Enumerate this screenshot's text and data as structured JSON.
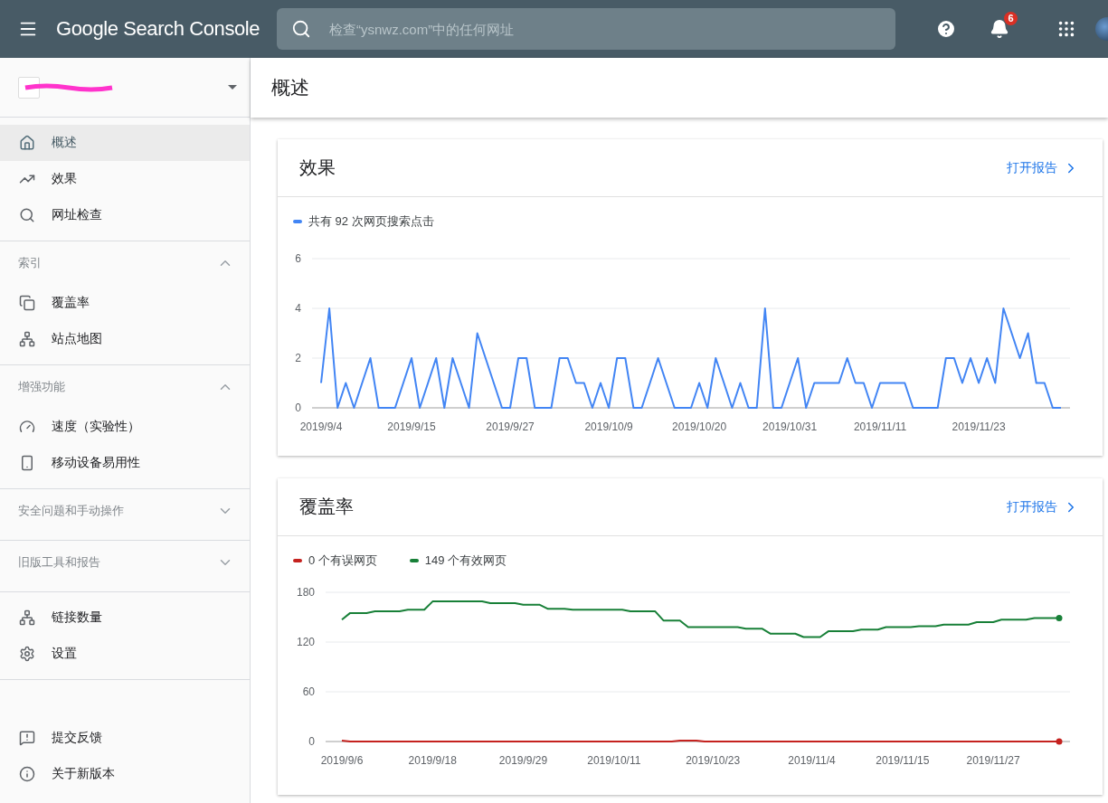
{
  "topbar": {
    "product": "Google Search Console",
    "search": {
      "placeholder": "检查“ysnwz.com”中的任何网址"
    },
    "notification_count": "6"
  },
  "nav": [
    {
      "items": [
        {
          "label": "概述",
          "selected": true
        },
        {
          "label": "效果",
          "selected": false
        },
        {
          "label": "网址检查",
          "selected": false
        }
      ]
    },
    {
      "title": "索引",
      "expanded": true,
      "items": [
        {
          "label": "覆盖率",
          "selected": false
        },
        {
          "label": "站点地图",
          "selected": false
        }
      ]
    },
    {
      "title": "增强功能",
      "expanded": true,
      "items": [
        {
          "label": "速度（实验性）",
          "selected": false
        },
        {
          "label": "移动设备易用性",
          "selected": false
        }
      ]
    },
    {
      "title": "安全问题和手动操作",
      "expanded": false
    },
    {
      "title": "旧版工具和报告",
      "expanded": false
    },
    {
      "items": [
        {
          "label": "链接数量",
          "selected": false
        },
        {
          "label": "设置",
          "selected": false
        }
      ]
    },
    {
      "items": [
        {
          "label": "提交反馈",
          "selected": false
        },
        {
          "label": "关于新版本",
          "selected": false
        }
      ]
    }
  ],
  "page_title": "概述",
  "cards": [
    {
      "title": "效果",
      "link": "打开报告",
      "x_axis_labels": [
        "2019/9/4",
        "2019/9/15",
        "2019/9/27",
        "2019/10/9",
        "2019/10/20",
        "2019/10/31",
        "2019/11/11",
        "2019/11/23"
      ],
      "chart_data": {
        "type": "line",
        "ylim": [
          0,
          6
        ],
        "yticks": [
          0,
          2,
          4,
          6
        ],
        "series": [
          {
            "name": "共有 92 次网页搜索点击",
            "color": "#4285f4",
            "values": [
              1,
              4,
              0,
              1,
              0,
              1,
              2,
              0,
              0,
              0,
              1,
              2,
              0,
              1,
              2,
              0,
              2,
              1,
              0,
              3,
              2,
              1,
              0,
              0,
              2,
              2,
              0,
              0,
              0,
              2,
              2,
              1,
              1,
              0,
              1,
              0,
              2,
              2,
              0,
              0,
              1,
              2,
              1,
              0,
              0,
              0,
              1,
              0,
              2,
              1,
              0,
              1,
              0,
              0,
              4,
              0,
              0,
              1,
              2,
              0,
              1,
              1,
              1,
              1,
              2,
              1,
              1,
              0,
              1,
              1,
              1,
              1,
              0,
              0,
              0,
              0,
              2,
              2,
              1,
              2,
              1,
              2,
              1,
              4,
              3,
              2,
              3,
              1,
              1,
              0,
              0
            ]
          }
        ]
      }
    },
    {
      "title": "覆盖率",
      "link": "打开报告",
      "x_axis_labels": [
        "2019/9/6",
        "2019/9/18",
        "2019/9/29",
        "2019/10/11",
        "2019/10/23",
        "2019/11/4",
        "2019/11/15",
        "2019/11/27"
      ],
      "chart_data": {
        "type": "line",
        "ylim": [
          0,
          180
        ],
        "yticks": [
          0,
          60,
          120,
          180
        ],
        "series": [
          {
            "name": "0 个有误网页",
            "color": "#c5221f",
            "values": [
              1,
              0,
              0,
              0,
              0,
              0,
              0,
              0,
              0,
              0,
              0,
              0,
              0,
              0,
              0,
              0,
              0,
              0,
              0,
              0,
              0,
              0,
              0,
              0,
              0,
              0,
              0,
              0,
              0,
              0,
              0,
              0,
              0,
              0,
              0,
              0,
              0,
              0,
              0,
              0,
              0,
              1,
              1,
              1,
              0,
              0,
              0,
              0,
              0,
              0,
              0,
              0,
              0,
              0,
              0,
              0,
              0,
              0,
              0,
              0,
              0,
              0,
              0,
              0,
              0,
              0,
              0,
              0,
              0,
              0,
              0,
              0,
              0,
              0,
              0,
              0,
              0,
              0,
              0,
              0,
              0,
              0,
              0,
              0,
              0,
              0,
              0,
              0
            ]
          },
          {
            "name": "149 个有效网页",
            "color": "#188038",
            "values": [
              147,
              155,
              155,
              155,
              157,
              157,
              157,
              157,
              159,
              159,
              159,
              169,
              169,
              169,
              169,
              169,
              169,
              169,
              167,
              167,
              167,
              167,
              165,
              165,
              165,
              160,
              160,
              160,
              159,
              159,
              159,
              159,
              159,
              159,
              159,
              157,
              157,
              157,
              157,
              146,
              146,
              146,
              138,
              138,
              138,
              138,
              138,
              138,
              138,
              136,
              136,
              136,
              130,
              130,
              130,
              130,
              126,
              126,
              126,
              133,
              133,
              133,
              133,
              135,
              135,
              135,
              138,
              138,
              138,
              138,
              139,
              139,
              139,
              141,
              141,
              141,
              141,
              144,
              144,
              144,
              147,
              147,
              147,
              147,
              149,
              149,
              149,
              149
            ]
          }
        ]
      }
    }
  ]
}
